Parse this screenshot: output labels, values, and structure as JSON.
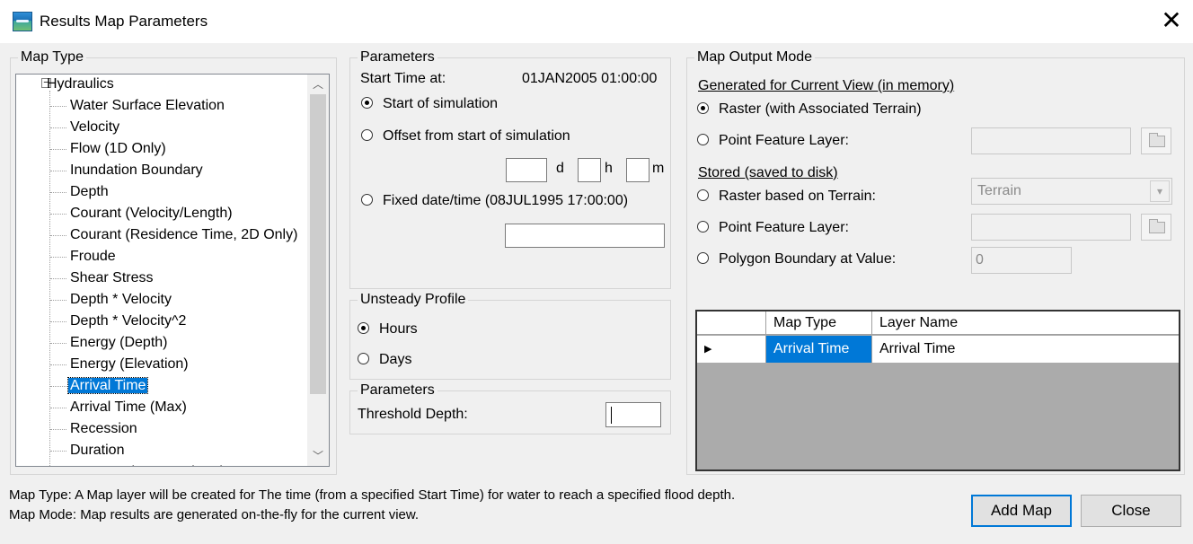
{
  "window": {
    "title": "Results Map Parameters",
    "close_glyph": "✕"
  },
  "map_type": {
    "legend": "Map Type",
    "root": "Hydraulics",
    "items": [
      "Water Surface Elevation",
      "Velocity",
      "Flow (1D Only)",
      "Inundation Boundary",
      "Depth",
      "Courant (Velocity/Length)",
      "Courant (Residence Time, 2D Only)",
      "Froude",
      "Shear Stress",
      "Depth * Velocity",
      "Depth * Velocity^2",
      "Energy (Depth)",
      "Energy (Elevation)",
      "Arrival Time",
      "Arrival Time (Max)",
      "Recession",
      "Duration",
      "Percent Time Inundated"
    ],
    "selected": "Arrival Time"
  },
  "parameters": {
    "legend": "Parameters",
    "start_time_label": "Start Time at:",
    "start_time_value": "01JAN2005 01:00:00",
    "opt_start": "Start of simulation",
    "opt_offset": "Offset from start of simulation",
    "unit_d": "d",
    "unit_h": "h",
    "unit_m": "m",
    "opt_fixed": "Fixed date/time (08JUL1995 17:00:00)",
    "selected": "Start of simulation"
  },
  "unsteady_profile": {
    "legend": "Unsteady Profile",
    "opt_hours": "Hours",
    "opt_days": "Days",
    "selected": "Hours"
  },
  "threshold": {
    "legend": "Parameters",
    "label": "Threshold Depth:",
    "value": ""
  },
  "output_mode": {
    "legend": "Map Output Mode",
    "generated_heading": "Generated for Current View (in memory)",
    "opt_raster": "Raster (with Associated Terrain)",
    "opt_point_mem": "Point Feature Layer:",
    "stored_heading": "Stored (saved to disk)",
    "opt_raster_terrain": "Raster based on Terrain:",
    "terrain_value": "Terrain",
    "opt_point_disk": "Point Feature Layer:",
    "opt_polygon": "Polygon Boundary at Value:",
    "polygon_value": "0",
    "selected": "Raster (with Associated Terrain)"
  },
  "layer_grid": {
    "headers": [
      "Map Type",
      "Layer Name"
    ],
    "rows": [
      {
        "map_type": "Arrival Time",
        "layer_name": "Arrival Time"
      }
    ],
    "row_indicator": "▶"
  },
  "status": {
    "line1": "Map Type: A Map layer will be created for The time (from a specified Start Time) for water to reach a specified flood depth.",
    "line2": "Map Mode: Map results are generated on-the-fly for the current view."
  },
  "buttons": {
    "add_map": "Add Map",
    "close": "Close"
  },
  "colors": {
    "selection": "#0078d7",
    "grid_background": "#ababab",
    "dialog_background": "#f0f0f0"
  }
}
